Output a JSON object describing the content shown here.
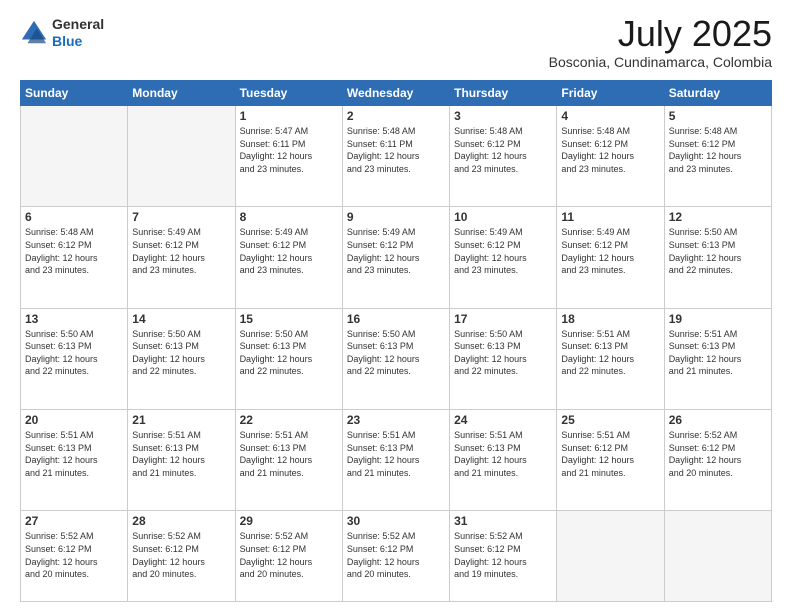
{
  "logo": {
    "general": "General",
    "blue": "Blue"
  },
  "title": "July 2025",
  "subtitle": "Bosconia, Cundinamarca, Colombia",
  "days_of_week": [
    "Sunday",
    "Monday",
    "Tuesday",
    "Wednesday",
    "Thursday",
    "Friday",
    "Saturday"
  ],
  "weeks": [
    [
      {
        "day": "",
        "info": ""
      },
      {
        "day": "",
        "info": ""
      },
      {
        "day": "1",
        "info": "Sunrise: 5:47 AM\nSunset: 6:11 PM\nDaylight: 12 hours\nand 23 minutes."
      },
      {
        "day": "2",
        "info": "Sunrise: 5:48 AM\nSunset: 6:11 PM\nDaylight: 12 hours\nand 23 minutes."
      },
      {
        "day": "3",
        "info": "Sunrise: 5:48 AM\nSunset: 6:12 PM\nDaylight: 12 hours\nand 23 minutes."
      },
      {
        "day": "4",
        "info": "Sunrise: 5:48 AM\nSunset: 6:12 PM\nDaylight: 12 hours\nand 23 minutes."
      },
      {
        "day": "5",
        "info": "Sunrise: 5:48 AM\nSunset: 6:12 PM\nDaylight: 12 hours\nand 23 minutes."
      }
    ],
    [
      {
        "day": "6",
        "info": "Sunrise: 5:48 AM\nSunset: 6:12 PM\nDaylight: 12 hours\nand 23 minutes."
      },
      {
        "day": "7",
        "info": "Sunrise: 5:49 AM\nSunset: 6:12 PM\nDaylight: 12 hours\nand 23 minutes."
      },
      {
        "day": "8",
        "info": "Sunrise: 5:49 AM\nSunset: 6:12 PM\nDaylight: 12 hours\nand 23 minutes."
      },
      {
        "day": "9",
        "info": "Sunrise: 5:49 AM\nSunset: 6:12 PM\nDaylight: 12 hours\nand 23 minutes."
      },
      {
        "day": "10",
        "info": "Sunrise: 5:49 AM\nSunset: 6:12 PM\nDaylight: 12 hours\nand 23 minutes."
      },
      {
        "day": "11",
        "info": "Sunrise: 5:49 AM\nSunset: 6:12 PM\nDaylight: 12 hours\nand 23 minutes."
      },
      {
        "day": "12",
        "info": "Sunrise: 5:50 AM\nSunset: 6:13 PM\nDaylight: 12 hours\nand 22 minutes."
      }
    ],
    [
      {
        "day": "13",
        "info": "Sunrise: 5:50 AM\nSunset: 6:13 PM\nDaylight: 12 hours\nand 22 minutes."
      },
      {
        "day": "14",
        "info": "Sunrise: 5:50 AM\nSunset: 6:13 PM\nDaylight: 12 hours\nand 22 minutes."
      },
      {
        "day": "15",
        "info": "Sunrise: 5:50 AM\nSunset: 6:13 PM\nDaylight: 12 hours\nand 22 minutes."
      },
      {
        "day": "16",
        "info": "Sunrise: 5:50 AM\nSunset: 6:13 PM\nDaylight: 12 hours\nand 22 minutes."
      },
      {
        "day": "17",
        "info": "Sunrise: 5:50 AM\nSunset: 6:13 PM\nDaylight: 12 hours\nand 22 minutes."
      },
      {
        "day": "18",
        "info": "Sunrise: 5:51 AM\nSunset: 6:13 PM\nDaylight: 12 hours\nand 22 minutes."
      },
      {
        "day": "19",
        "info": "Sunrise: 5:51 AM\nSunset: 6:13 PM\nDaylight: 12 hours\nand 21 minutes."
      }
    ],
    [
      {
        "day": "20",
        "info": "Sunrise: 5:51 AM\nSunset: 6:13 PM\nDaylight: 12 hours\nand 21 minutes."
      },
      {
        "day": "21",
        "info": "Sunrise: 5:51 AM\nSunset: 6:13 PM\nDaylight: 12 hours\nand 21 minutes."
      },
      {
        "day": "22",
        "info": "Sunrise: 5:51 AM\nSunset: 6:13 PM\nDaylight: 12 hours\nand 21 minutes."
      },
      {
        "day": "23",
        "info": "Sunrise: 5:51 AM\nSunset: 6:13 PM\nDaylight: 12 hours\nand 21 minutes."
      },
      {
        "day": "24",
        "info": "Sunrise: 5:51 AM\nSunset: 6:13 PM\nDaylight: 12 hours\nand 21 minutes."
      },
      {
        "day": "25",
        "info": "Sunrise: 5:51 AM\nSunset: 6:12 PM\nDaylight: 12 hours\nand 21 minutes."
      },
      {
        "day": "26",
        "info": "Sunrise: 5:52 AM\nSunset: 6:12 PM\nDaylight: 12 hours\nand 20 minutes."
      }
    ],
    [
      {
        "day": "27",
        "info": "Sunrise: 5:52 AM\nSunset: 6:12 PM\nDaylight: 12 hours\nand 20 minutes."
      },
      {
        "day": "28",
        "info": "Sunrise: 5:52 AM\nSunset: 6:12 PM\nDaylight: 12 hours\nand 20 minutes."
      },
      {
        "day": "29",
        "info": "Sunrise: 5:52 AM\nSunset: 6:12 PM\nDaylight: 12 hours\nand 20 minutes."
      },
      {
        "day": "30",
        "info": "Sunrise: 5:52 AM\nSunset: 6:12 PM\nDaylight: 12 hours\nand 20 minutes."
      },
      {
        "day": "31",
        "info": "Sunrise: 5:52 AM\nSunset: 6:12 PM\nDaylight: 12 hours\nand 19 minutes."
      },
      {
        "day": "",
        "info": ""
      },
      {
        "day": "",
        "info": ""
      }
    ]
  ]
}
